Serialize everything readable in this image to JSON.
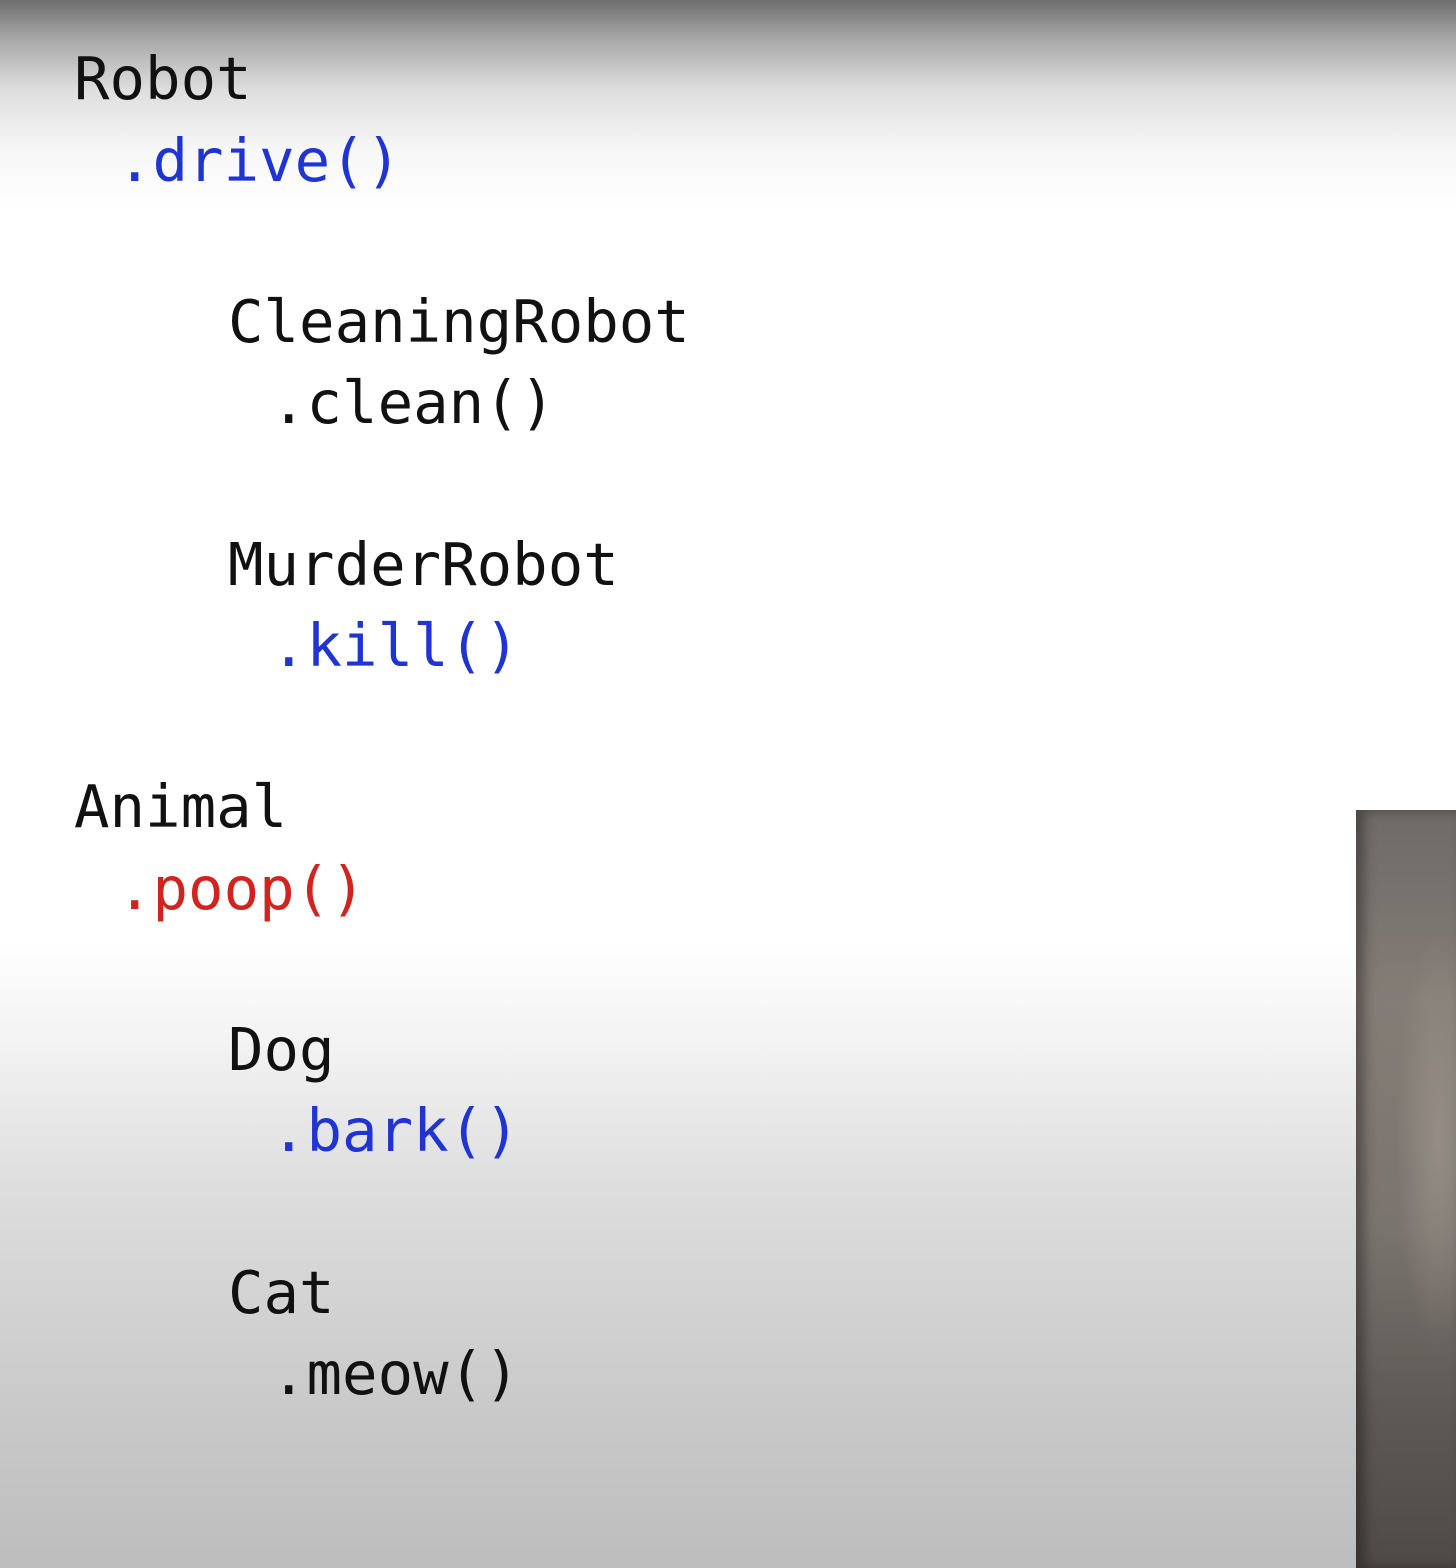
{
  "slide": {
    "classes": [
      {
        "name": "Robot",
        "method": ".drive()",
        "method_color": "#1f34d1",
        "subclasses": [
          {
            "name": "CleaningRobot",
            "method": ".clean()",
            "method_color": "#111111"
          },
          {
            "name": "MurderRobot",
            "method": ".kill()",
            "method_color": "#1f34d1"
          }
        ]
      },
      {
        "name": "Animal",
        "method": ".poop()",
        "method_color": "#d0251f",
        "subclasses": [
          {
            "name": "Dog",
            "method": ".bark()",
            "method_color": "#1f34d1"
          },
          {
            "name": "Cat",
            "method": ".meow()",
            "method_color": "#111111"
          }
        ]
      }
    ]
  },
  "colors": {
    "text": "#111111",
    "highlight_blue": "#1f34d1",
    "highlight_red": "#d0251f"
  }
}
